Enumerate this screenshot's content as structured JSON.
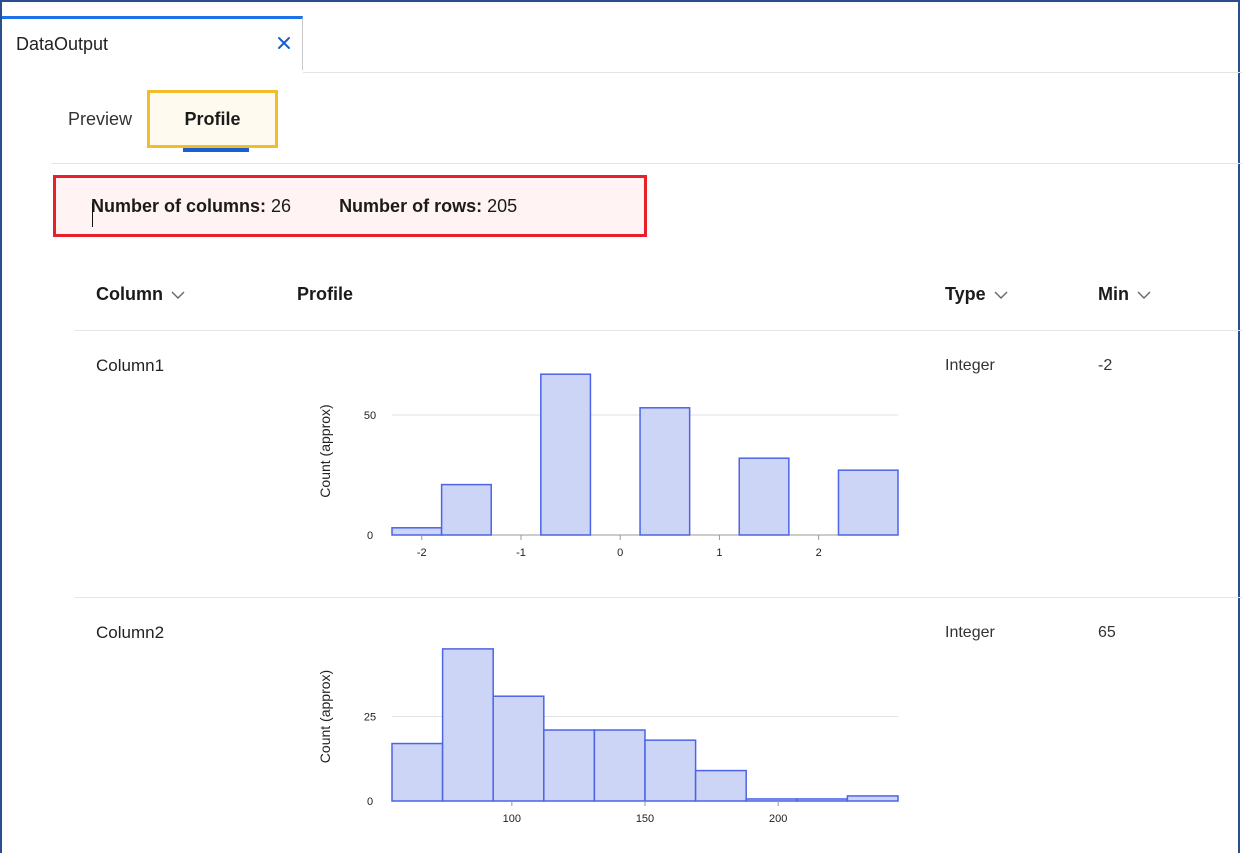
{
  "document_tab": {
    "title": "DataOutput",
    "close_icon": "close-icon",
    "accent": "#1a73e8"
  },
  "subtabs": [
    {
      "label": "Preview",
      "active": false
    },
    {
      "label": "Profile",
      "active": true
    }
  ],
  "stats": {
    "columns_label": "Number of columns:",
    "columns_value": "26",
    "rows_label": "Number of rows:",
    "rows_value": "205"
  },
  "table": {
    "headers": {
      "column": "Column",
      "profile": "Profile",
      "type": "Type",
      "min": "Min"
    },
    "rows": [
      {
        "name": "Column1",
        "type": "Integer",
        "min": "-2"
      },
      {
        "name": "Column2",
        "type": "Integer",
        "min": "65"
      }
    ]
  },
  "chart_data": [
    {
      "type": "bar",
      "ylabel": "Count (approx)",
      "xlim": [
        -2.3,
        2.8
      ],
      "ylim": [
        0,
        70
      ],
      "yticks": [
        0,
        50
      ],
      "xticks": [
        -2,
        -1,
        0,
        1,
        2
      ],
      "bin_edges": [
        -2.3,
        -1.8,
        -1.3,
        -0.8,
        -0.3,
        0.2,
        0.7,
        1.2,
        1.7,
        2.2,
        2.8
      ],
      "values": [
        3,
        21,
        0,
        67,
        0,
        53,
        0,
        32,
        0,
        27
      ],
      "bar_color": "#cdd5f7",
      "edge_color": "#4c64e6"
    },
    {
      "type": "bar",
      "ylabel": "Count (approx)",
      "xlim": [
        55,
        245
      ],
      "ylim": [
        0,
        50
      ],
      "yticks": [
        0,
        25
      ],
      "xticks": [
        100,
        150,
        200
      ],
      "bin_edges": [
        55,
        74,
        93,
        112,
        131,
        150,
        169,
        188,
        207,
        226,
        245
      ],
      "values": [
        17,
        45,
        31,
        21,
        21,
        18,
        9,
        0.6,
        0.6,
        1.5
      ],
      "bar_color": "#cdd5f7",
      "edge_color": "#4c64e6"
    }
  ]
}
